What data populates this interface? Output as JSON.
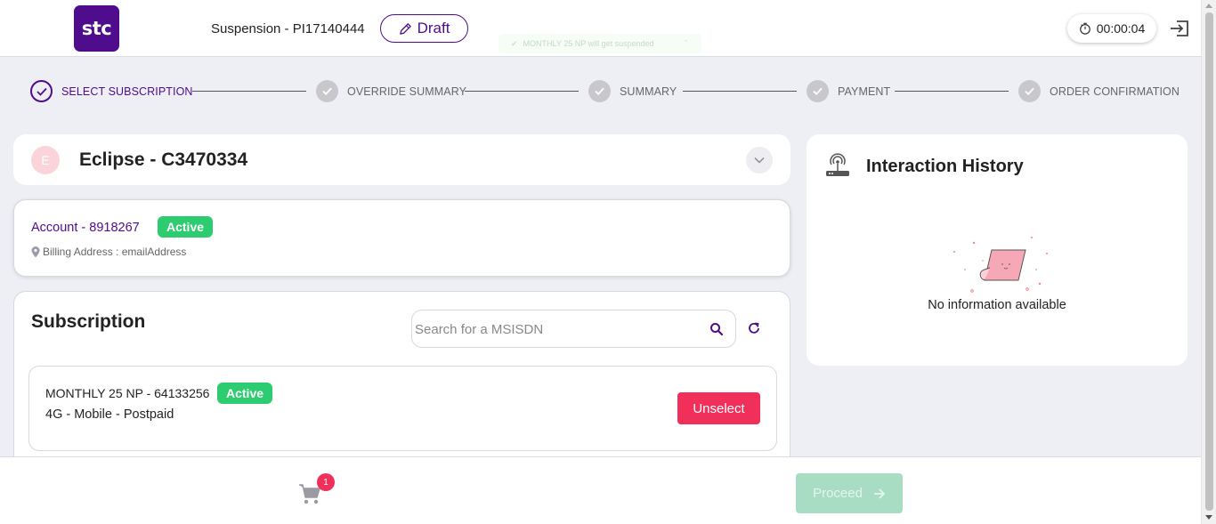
{
  "header": {
    "logo_text": "stc",
    "title": "Suspension - PI17140444",
    "draft_label": "Draft",
    "toast_text": "MONTHLY 25 NP will get suspended",
    "timer": "00:00:04"
  },
  "steps": [
    {
      "label": "SELECT SUBSCRIPTION",
      "state": "active"
    },
    {
      "label": "OVERRIDE SUMMARY",
      "state": "pending"
    },
    {
      "label": "SUMMARY",
      "state": "pending"
    },
    {
      "label": "PAYMENT",
      "state": "pending"
    },
    {
      "label": "ORDER CONFIRMATION",
      "state": "pending"
    }
  ],
  "customer": {
    "avatar_initial": "E",
    "name": "Eclipse - C3470334"
  },
  "account": {
    "label": "Account - 8918267",
    "status": "Active",
    "billing": "Billing Address : emailAddress"
  },
  "subscription": {
    "title": "Subscription",
    "search_placeholder": "Search for a MSISDN",
    "items": [
      {
        "name": "MONTHLY 25 NP - 64133256",
        "status": "Active",
        "type": "4G - Mobile - Postpaid",
        "action_label": "Unselect"
      }
    ]
  },
  "history": {
    "title": "Interaction History",
    "empty_text": "No information available"
  },
  "footer": {
    "cart_count": "1",
    "proceed_label": "Proceed"
  },
  "colors": {
    "brand": "#4f0c8c",
    "success": "#2ecc71",
    "danger": "#f0305a",
    "proceed_disabled": "#a8ddc3",
    "background": "#eeeef5"
  }
}
